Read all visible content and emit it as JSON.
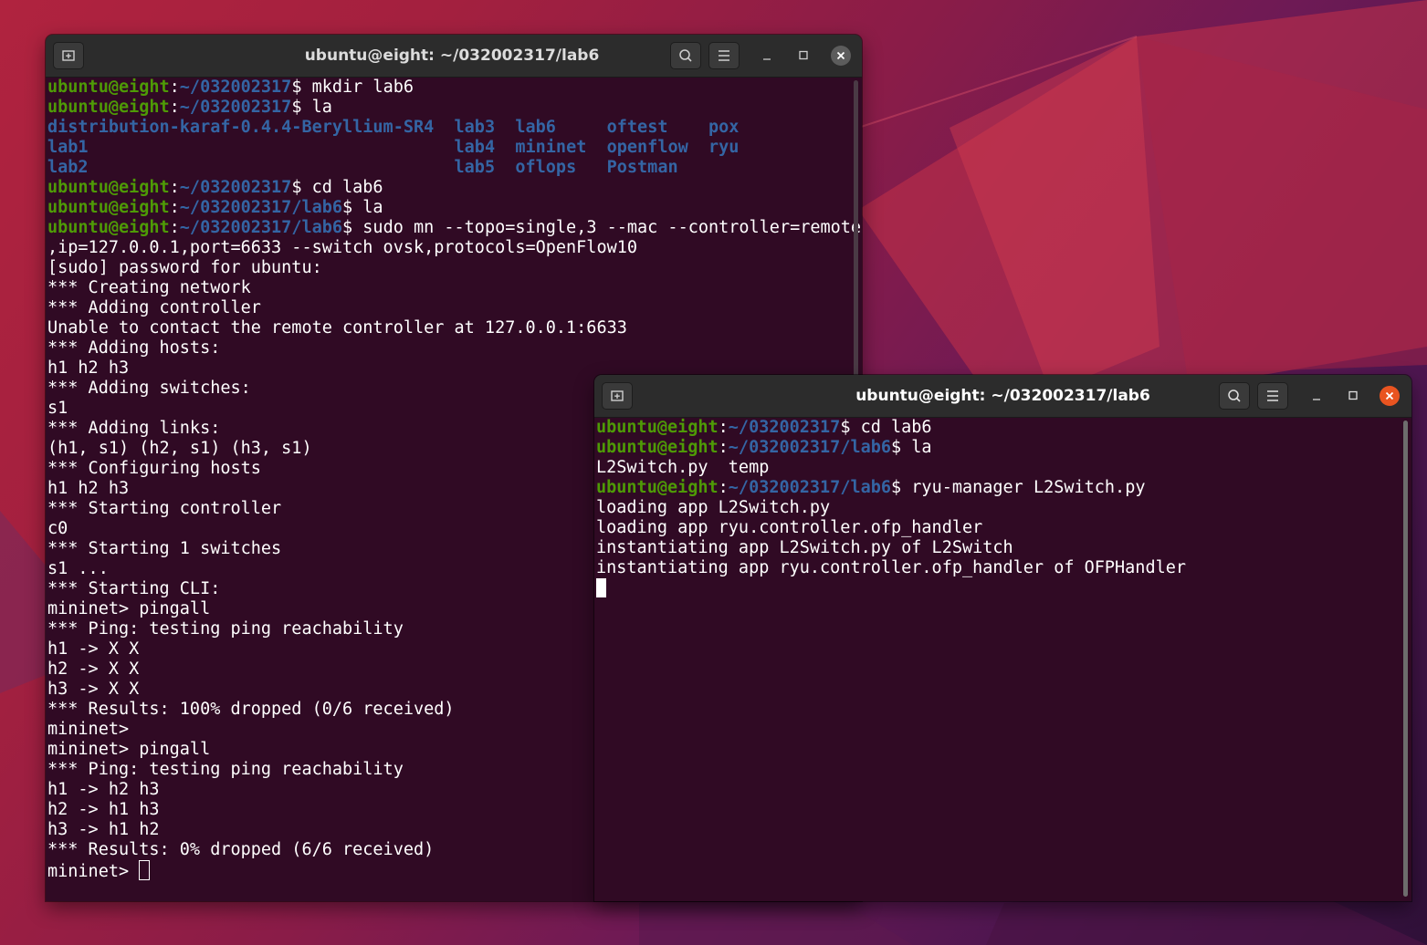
{
  "desktop": {
    "wallpaper_colors": [
      "#b0233f",
      "#6e1a55",
      "#2f1038"
    ]
  },
  "window_left": {
    "title": "ubuntu@eight: ~/032002317/lab6",
    "icons": {
      "new_tab": "new-tab-icon",
      "search": "search-icon",
      "menu": "hamburger-menu-icon",
      "minimize": "minimize-icon",
      "maximize": "maximize-icon",
      "close": "close-icon"
    },
    "lines": [
      [
        {
          "t": "ubuntu@eight",
          "c": "g"
        },
        {
          "t": ":"
        },
        {
          "t": "~/032002317",
          "c": "b"
        },
        {
          "t": "$ mkdir lab6"
        }
      ],
      [
        {
          "t": "ubuntu@eight",
          "c": "g"
        },
        {
          "t": ":"
        },
        {
          "t": "~/032002317",
          "c": "b"
        },
        {
          "t": "$ la"
        }
      ],
      [
        {
          "t": "distribution-karaf-0.4.4-Beryllium-SR4",
          "c": "b"
        },
        {
          "t": "  "
        },
        {
          "t": "lab3",
          "c": "b"
        },
        {
          "t": "  "
        },
        {
          "t": "lab6",
          "c": "b"
        },
        {
          "t": "     "
        },
        {
          "t": "oftest",
          "c": "b"
        },
        {
          "t": "    "
        },
        {
          "t": "pox",
          "c": "b"
        }
      ],
      [
        {
          "t": "lab1",
          "c": "b"
        },
        {
          "t": "                                    "
        },
        {
          "t": "lab4",
          "c": "b"
        },
        {
          "t": "  "
        },
        {
          "t": "mininet",
          "c": "b"
        },
        {
          "t": "  "
        },
        {
          "t": "openflow",
          "c": "b"
        },
        {
          "t": "  "
        },
        {
          "t": "ryu",
          "c": "b"
        }
      ],
      [
        {
          "t": "lab2",
          "c": "b"
        },
        {
          "t": "                                    "
        },
        {
          "t": "lab5",
          "c": "b"
        },
        {
          "t": "  "
        },
        {
          "t": "oflops",
          "c": "b"
        },
        {
          "t": "   "
        },
        {
          "t": "Postman",
          "c": "b"
        }
      ],
      [
        {
          "t": "ubuntu@eight",
          "c": "g"
        },
        {
          "t": ":"
        },
        {
          "t": "~/032002317",
          "c": "b"
        },
        {
          "t": "$ cd lab6"
        }
      ],
      [
        {
          "t": "ubuntu@eight",
          "c": "g"
        },
        {
          "t": ":"
        },
        {
          "t": "~/032002317/lab6",
          "c": "b"
        },
        {
          "t": "$ la"
        }
      ],
      [
        {
          "t": "ubuntu@eight",
          "c": "g"
        },
        {
          "t": ":"
        },
        {
          "t": "~/032002317/lab6",
          "c": "b"
        },
        {
          "t": "$ sudo mn --topo=single,3 --mac --controller=remote"
        }
      ],
      [
        {
          "t": ",ip=127.0.0.1,port=6633 --switch ovsk,protocols=OpenFlow10"
        }
      ],
      [
        {
          "t": "[sudo] password for ubuntu:"
        }
      ],
      [
        {
          "t": "*** Creating network"
        }
      ],
      [
        {
          "t": "*** Adding controller"
        }
      ],
      [
        {
          "t": "Unable to contact the remote controller at 127.0.0.1:6633"
        }
      ],
      [
        {
          "t": "*** Adding hosts:"
        }
      ],
      [
        {
          "t": "h1 h2 h3"
        }
      ],
      [
        {
          "t": "*** Adding switches:"
        }
      ],
      [
        {
          "t": "s1"
        }
      ],
      [
        {
          "t": "*** Adding links:"
        }
      ],
      [
        {
          "t": "(h1, s1) (h2, s1) (h3, s1)"
        }
      ],
      [
        {
          "t": "*** Configuring hosts"
        }
      ],
      [
        {
          "t": "h1 h2 h3"
        }
      ],
      [
        {
          "t": "*** Starting controller"
        }
      ],
      [
        {
          "t": "c0"
        }
      ],
      [
        {
          "t": "*** Starting 1 switches"
        }
      ],
      [
        {
          "t": "s1 ..."
        }
      ],
      [
        {
          "t": "*** Starting CLI:"
        }
      ],
      [
        {
          "t": "mininet> pingall"
        }
      ],
      [
        {
          "t": "*** Ping: testing ping reachability"
        }
      ],
      [
        {
          "t": "h1 -> X X"
        }
      ],
      [
        {
          "t": "h2 -> X X"
        }
      ],
      [
        {
          "t": "h3 -> X X"
        }
      ],
      [
        {
          "t": "*** Results: 100% dropped (0/6 received)"
        }
      ],
      [
        {
          "t": "mininet>"
        }
      ],
      [
        {
          "t": "mininet> pingall"
        }
      ],
      [
        {
          "t": "*** Ping: testing ping reachability"
        }
      ],
      [
        {
          "t": "h1 -> h2 h3"
        }
      ],
      [
        {
          "t": "h2 -> h1 h3"
        }
      ],
      [
        {
          "t": "h3 -> h1 h2"
        }
      ],
      [
        {
          "t": "*** Results: 0% dropped (6/6 received)"
        }
      ],
      [
        {
          "t": "mininet> "
        },
        {
          "cursor": "hollow"
        }
      ]
    ]
  },
  "window_right": {
    "title": "ubuntu@eight: ~/032002317/lab6",
    "icons": {
      "new_tab": "new-tab-icon",
      "search": "search-icon",
      "menu": "hamburger-menu-icon",
      "minimize": "minimize-icon",
      "maximize": "maximize-icon",
      "close": "close-icon"
    },
    "lines": [
      [
        {
          "t": "ubuntu@eight",
          "c": "g"
        },
        {
          "t": ":"
        },
        {
          "t": "~/032002317",
          "c": "b"
        },
        {
          "t": "$ cd lab6"
        }
      ],
      [
        {
          "t": "ubuntu@eight",
          "c": "g"
        },
        {
          "t": ":"
        },
        {
          "t": "~/032002317/lab6",
          "c": "b"
        },
        {
          "t": "$ la"
        }
      ],
      [
        {
          "t": "L2Switch.py  temp"
        }
      ],
      [
        {
          "t": "ubuntu@eight",
          "c": "g"
        },
        {
          "t": ":"
        },
        {
          "t": "~/032002317/lab6",
          "c": "b"
        },
        {
          "t": "$ ryu-manager L2Switch.py"
        }
      ],
      [
        {
          "t": "loading app L2Switch.py"
        }
      ],
      [
        {
          "t": "loading app ryu.controller.ofp_handler"
        }
      ],
      [
        {
          "t": "instantiating app L2Switch.py of L2Switch"
        }
      ],
      [
        {
          "t": "instantiating app ryu.controller.ofp_handler of OFPHandler"
        }
      ],
      [
        {
          "cursor": "block"
        }
      ]
    ]
  },
  "colors": {
    "terminal_bg": "#300a24",
    "titlebar_bg": "#2c2c2c",
    "prompt_user": "#4e9a06",
    "prompt_path": "#3465a4",
    "close_active": "#e95420",
    "close_inactive": "#5c5c5c"
  }
}
